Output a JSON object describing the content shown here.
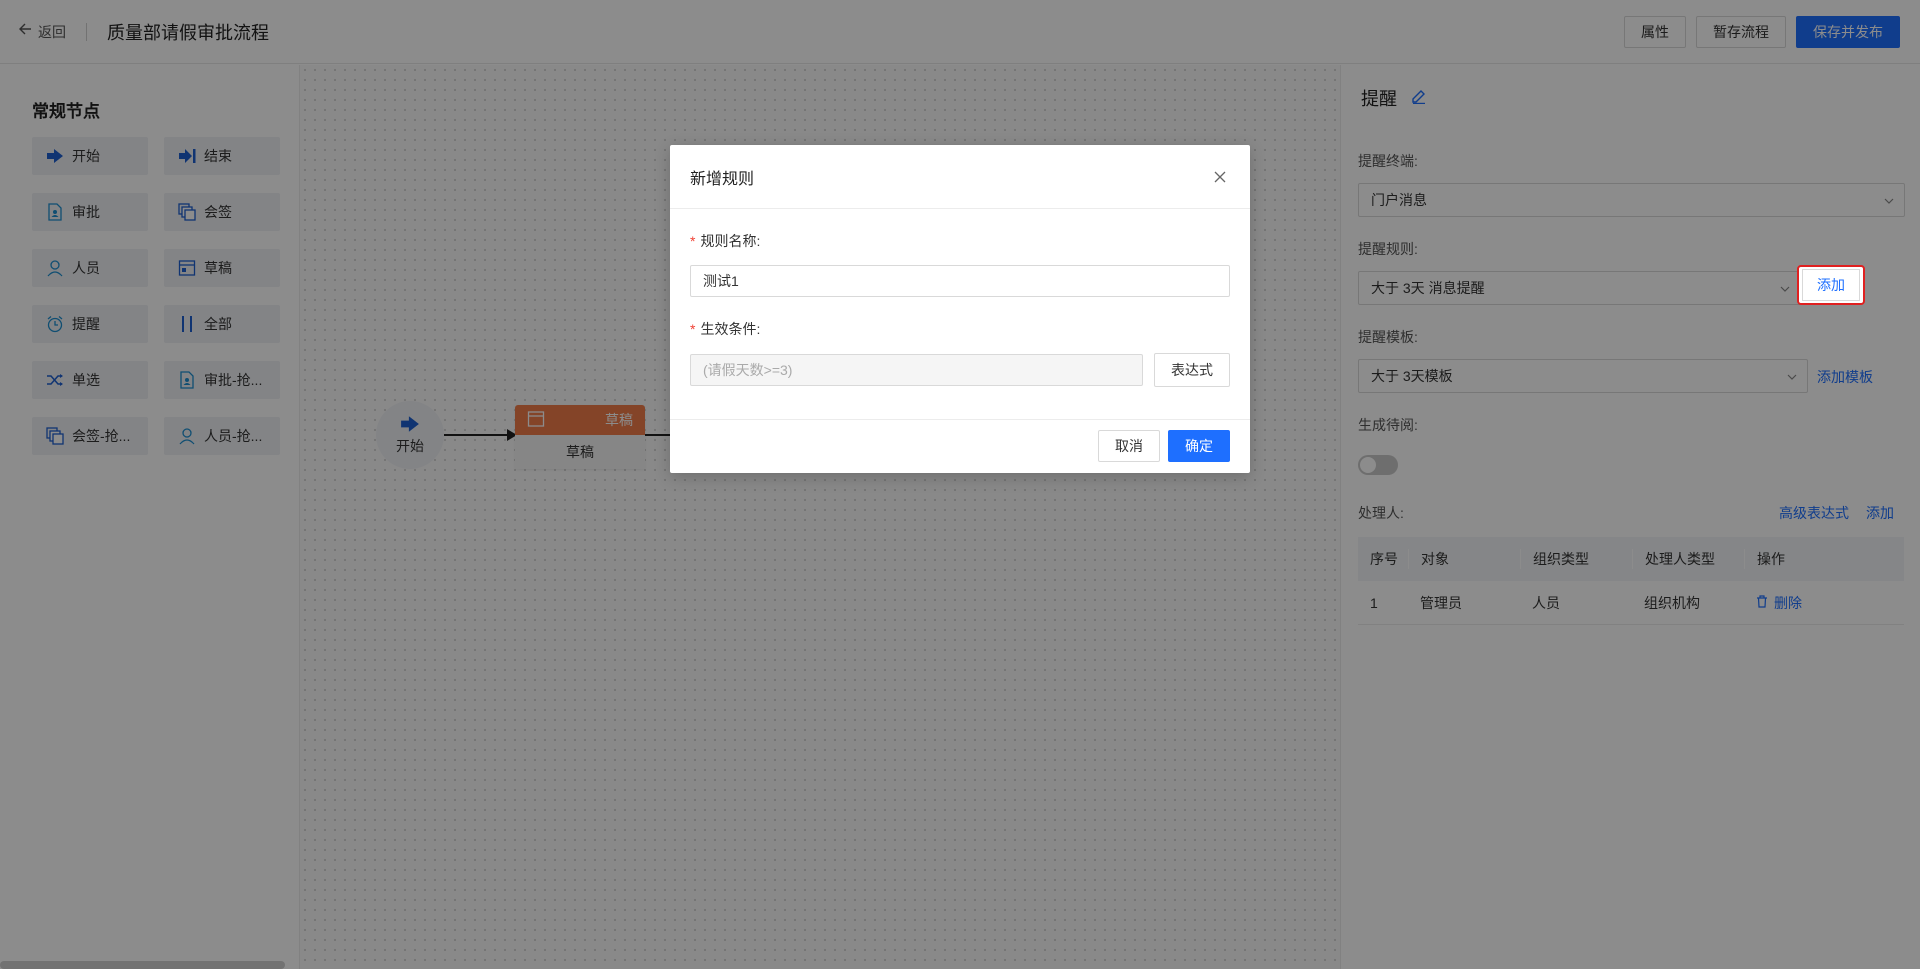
{
  "header": {
    "back_label": "返回",
    "title": "质量部请假审批流程",
    "attr_label": "属性",
    "draft_label": "暂存流程",
    "publish_label": "保存并发布"
  },
  "palette": {
    "title": "常规节点",
    "items": [
      {
        "label": "开始",
        "icon": "arrow-right-icon"
      },
      {
        "label": "结束",
        "icon": "arrow-end-icon"
      },
      {
        "label": "审批",
        "icon": "document-user-icon"
      },
      {
        "label": "会签",
        "icon": "stack-icon"
      },
      {
        "label": "人员",
        "icon": "user-icon"
      },
      {
        "label": "草稿",
        "icon": "calendar-icon"
      },
      {
        "label": "提醒",
        "icon": "alarm-clock-icon"
      },
      {
        "label": "全部",
        "icon": "parallel-bars-icon"
      },
      {
        "label": "单选",
        "icon": "shuffle-icon"
      },
      {
        "label": "审批-抢...",
        "icon": "document-user-icon"
      },
      {
        "label": "会签-抢...",
        "icon": "stack-icon"
      },
      {
        "label": "人员-抢...",
        "icon": "user-icon"
      }
    ]
  },
  "canvas": {
    "start_label": "开始",
    "draft_head_label": "草稿",
    "draft_body_label": "草稿",
    "accent_color": "#f07c4a"
  },
  "panel": {
    "title": "提醒",
    "terminal_label": "提醒终端:",
    "terminal_value": "门户消息",
    "rule_label": "提醒规则:",
    "rule_value": "大于 3天 消息提醒",
    "rule_add": "添加",
    "template_label": "提醒模板:",
    "template_value": "大于 3天模板",
    "template_add": "添加模板",
    "todo_label": "生成待阅:",
    "todo_enabled": false,
    "handler_label": "处理人:",
    "advanced_expr": "高级表达式",
    "handler_add": "添加",
    "table": {
      "headers": [
        "序号",
        "对象",
        "组织类型",
        "处理人类型",
        "操作"
      ],
      "rows": [
        {
          "index": "1",
          "object": "管理员",
          "org_type": "人员",
          "handler_type": "组织机构",
          "action": "删除"
        }
      ]
    }
  },
  "modal": {
    "title": "新增规则",
    "name_label": "规则名称:",
    "name_value": "测试1",
    "condition_label": "生效条件:",
    "condition_value": "(请假天数>=3)",
    "expr_label": "表达式",
    "cancel_label": "取消",
    "ok_label": "确定"
  },
  "colors": {
    "primary": "#1e6fff",
    "highlight_border": "#e02020"
  }
}
